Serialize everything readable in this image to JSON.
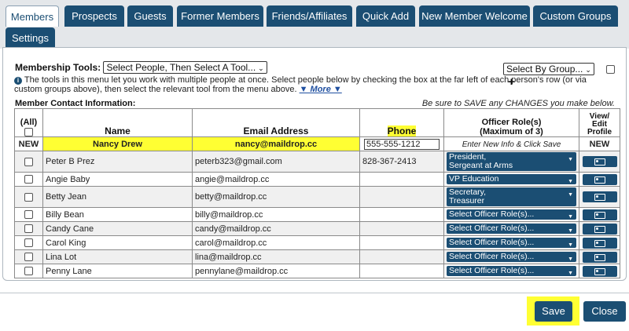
{
  "tabs": [
    {
      "label": "Members"
    },
    {
      "label": "Prospects"
    },
    {
      "label": "Guests"
    },
    {
      "label": "Former Members"
    },
    {
      "label": "Friends/Affiliates"
    },
    {
      "label": "Quick Add"
    },
    {
      "label": "New Member Welcome"
    },
    {
      "label": "Custom Groups"
    },
    {
      "label": "Settings"
    }
  ],
  "tools": {
    "label": "Membership Tools:",
    "select_value": "Select People, Then Select A Tool...",
    "group_select": "Select By Group...",
    "plus": "+",
    "info_text": "The tools in this menu let you work with multiple people at once. Select people below by checking the box at the far left of each person's row (or via custom groups above), then select the relevant tool from the menu above.",
    "more_link": "▼ More ▼"
  },
  "contact": {
    "title": "Member Contact Information:",
    "save_note": "Be sure to SAVE any CHANGES you make below.",
    "headers": {
      "all": "(All)",
      "name": "Name",
      "email": "Email Address",
      "phone": "Phone",
      "officer_line1": "Officer Role(s)",
      "officer_line2": "(Maximum of 3)",
      "view1": "View/",
      "view2": "Edit",
      "view3": "Profile"
    },
    "new_row": {
      "tag": "NEW",
      "name": "Nancy Drew",
      "email": "nancy@maildrop.cc",
      "phone": "555-555-1212",
      "officer_note": "Enter New Info & Click Save",
      "profile": "NEW"
    },
    "members": [
      {
        "name": "Peter B Prez",
        "email": "peterb323@gmail.com",
        "phone": "828-367-2413",
        "role1": "President,",
        "role2": "Sergeant at Arms"
      },
      {
        "name": "Angie Baby",
        "email": "angie@maildrop.cc",
        "phone": "",
        "role1": "VP Education",
        "role2": ""
      },
      {
        "name": "Betty Jean",
        "email": "betty@maildrop.cc",
        "phone": "",
        "role1": "Secretary,",
        "role2": "Treasurer"
      },
      {
        "name": "Billy Bean",
        "email": "billy@maildrop.cc",
        "phone": "",
        "role1": "Select Officer Role(s)...",
        "role2": ""
      },
      {
        "name": "Candy Cane",
        "email": "candy@maildrop.cc",
        "phone": "",
        "role1": "Select Officer Role(s)...",
        "role2": ""
      },
      {
        "name": "Carol King",
        "email": "carol@maildrop.cc",
        "phone": "",
        "role1": "Select Officer Role(s)...",
        "role2": ""
      },
      {
        "name": "Lina Lot",
        "email": "lina@maildrop.cc",
        "phone": "",
        "role1": "Select Officer Role(s)...",
        "role2": ""
      },
      {
        "name": "Penny Lane",
        "email": "pennylane@maildrop.cc",
        "phone": "",
        "role1": "Select Officer Role(s)...",
        "role2": ""
      }
    ]
  },
  "buttons": {
    "save": "Save",
    "close": "Close"
  },
  "colors": {
    "accent": "#1b4e73",
    "highlight": "#ffff33"
  }
}
